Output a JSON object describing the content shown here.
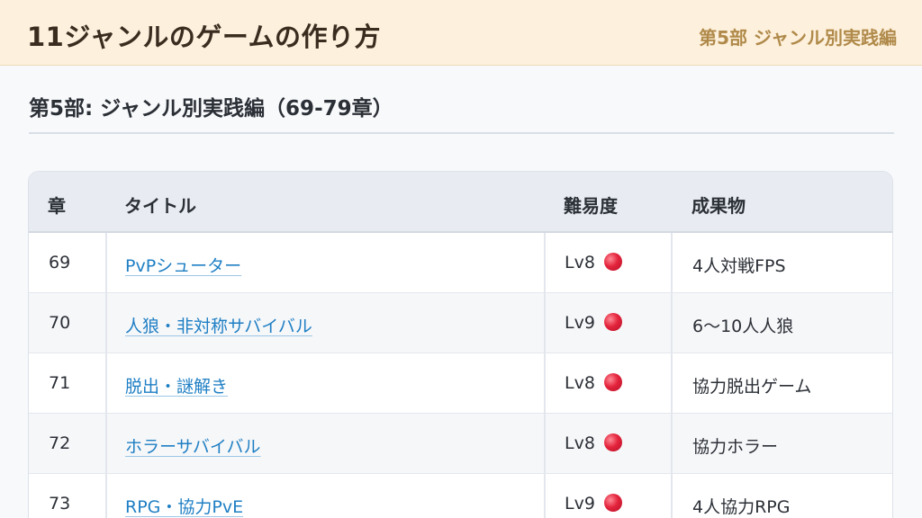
{
  "header": {
    "site_title": "11ジャンルのゲームの作り方",
    "part_label": "第5部 ジャンル別実践編"
  },
  "section": {
    "heading": "第5部: ジャンル別実践編（69-79章）"
  },
  "table": {
    "columns": {
      "chapter": "章",
      "title": "タイトル",
      "difficulty": "難易度",
      "output": "成果物"
    },
    "rows": [
      {
        "chapter": "69",
        "title": "PvPシューター",
        "difficulty": "Lv8",
        "output": "4人対戦FPS"
      },
      {
        "chapter": "70",
        "title": "人狼・非対称サバイバル",
        "difficulty": "Lv9",
        "output": "6〜10人人狼"
      },
      {
        "chapter": "71",
        "title": "脱出・謎解き",
        "difficulty": "Lv8",
        "output": "協力脱出ゲーム"
      },
      {
        "chapter": "72",
        "title": "ホラーサバイバル",
        "difficulty": "Lv8",
        "output": "協力ホラー"
      },
      {
        "chapter": "73",
        "title": "RPG・協力PvE",
        "difficulty": "Lv9",
        "output": "4人協力RPG"
      }
    ],
    "difficulty_icon": "red-circle-icon",
    "colors": {
      "link": "#1f7fc4",
      "header_bg": "#fdf0dc",
      "dot": "#e3243c"
    }
  }
}
